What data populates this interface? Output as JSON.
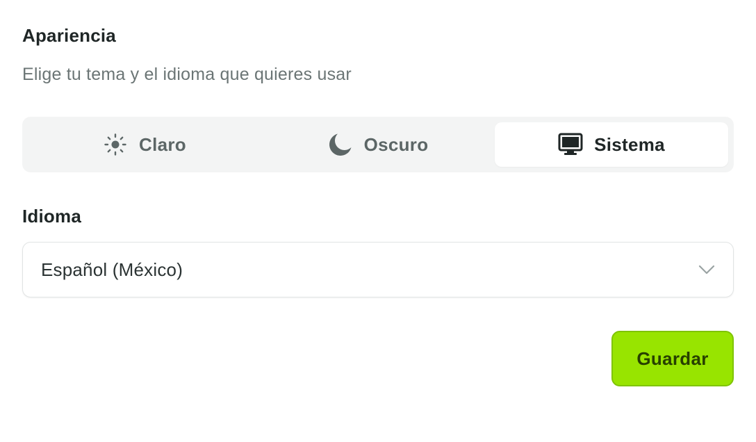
{
  "appearance": {
    "title": "Apariencia",
    "subtitle": "Elige tu tema y el idioma que quieres usar",
    "theme_options": [
      {
        "label": "Claro",
        "icon": "sun-icon",
        "active": false
      },
      {
        "label": "Oscuro",
        "icon": "moon-icon",
        "active": false
      },
      {
        "label": "Sistema",
        "icon": "monitor-icon",
        "active": true
      }
    ]
  },
  "language": {
    "label": "Idioma",
    "selected": "Español (México)",
    "dropdown_icon": "chevron-down-icon"
  },
  "actions": {
    "save_label": "Guardar"
  },
  "colors": {
    "accent": "#98e400",
    "accent_border": "#7fc400",
    "switch_bg": "#f3f4f4",
    "text_primary": "#1f2626",
    "text_muted": "#6b7575"
  }
}
